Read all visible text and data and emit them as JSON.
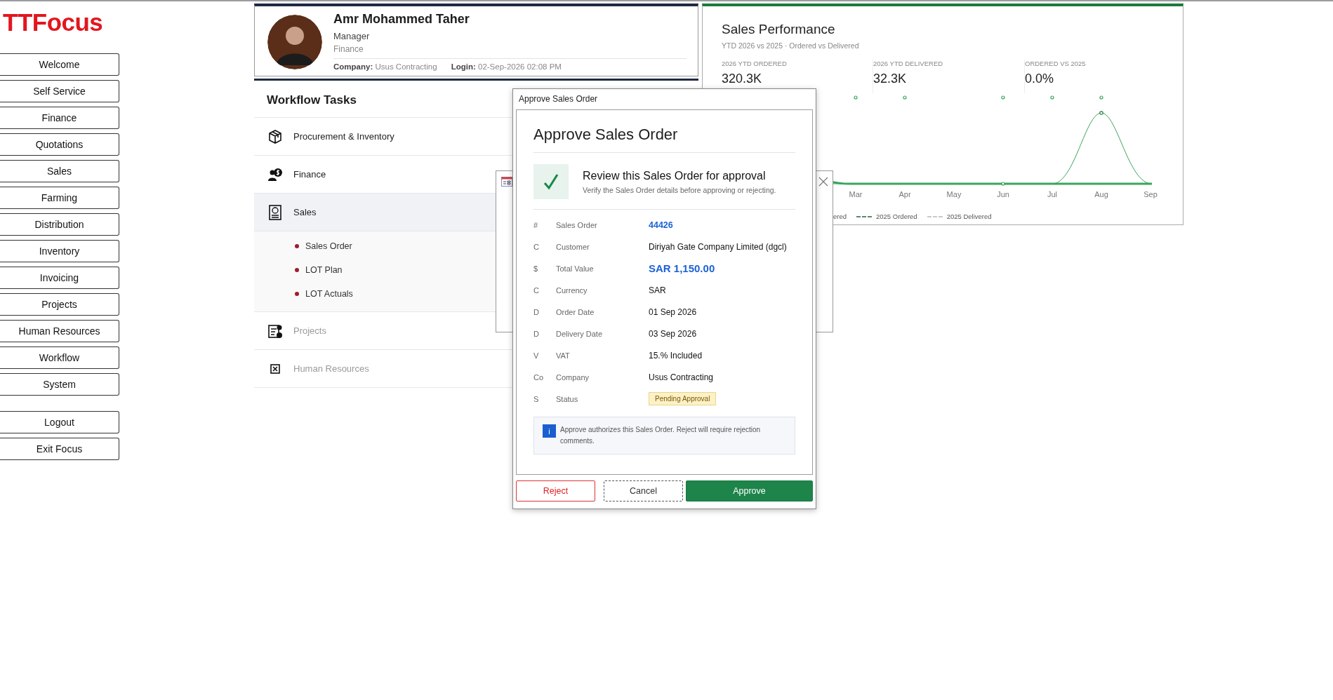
{
  "logo": "TTFocus",
  "nav": [
    {
      "label": "Welcome"
    },
    {
      "label": "Self Service"
    },
    {
      "label": "Finance"
    },
    {
      "label": "Quotations"
    },
    {
      "label": "Sales"
    },
    {
      "label": "Farming"
    },
    {
      "label": "Distribution"
    },
    {
      "label": "Inventory"
    },
    {
      "label": "Invoicing"
    },
    {
      "label": "Projects"
    },
    {
      "label": "Human Resources"
    },
    {
      "label": "Workflow"
    },
    {
      "label": "System"
    }
  ],
  "nav_bottom": [
    {
      "label": "Logout"
    },
    {
      "label": "Exit Focus"
    }
  ],
  "profile": {
    "name": "Amr Mohammed Taher",
    "role": "Manager",
    "department": "Finance",
    "company_label": "Company:",
    "company": "Usus Contracting",
    "login_label": "Login:",
    "login": "02-Sep-2026 02:08 PM"
  },
  "workflow": {
    "title": "Workflow Tasks",
    "items": [
      {
        "label": "Procurement & Inventory",
        "selected": false,
        "disabled": false
      },
      {
        "label": "Finance",
        "selected": false,
        "disabled": false
      },
      {
        "label": "Sales",
        "selected": true,
        "disabled": false,
        "children": [
          {
            "label": "Sales Order"
          },
          {
            "label": "LOT Plan"
          },
          {
            "label": "LOT Actuals"
          }
        ]
      },
      {
        "label": "Projects",
        "selected": false,
        "disabled": true
      },
      {
        "label": "Human Resources",
        "selected": false,
        "disabled": true
      }
    ]
  },
  "sales_performance": {
    "title": "Sales Performance",
    "subtitle": "YTD 2026 vs 2025 · Ordered vs Delivered",
    "kpis": [
      {
        "label": "2026 YTD ORDERED",
        "value": "320.3K"
      },
      {
        "label": "2026 YTD DELIVERED",
        "value": "32.3K"
      },
      {
        "label": "ORDERED VS 2025",
        "value": "0.0%"
      }
    ],
    "months": [
      "Mar",
      "Apr",
      "May",
      "Jun",
      "Jul",
      "Aug",
      "Sep"
    ],
    "legend": [
      {
        "label": "ered"
      },
      {
        "label": "2025 Ordered",
        "color": "#5a8a6a"
      },
      {
        "label": "2025 Delivered",
        "color": "#c4ccc6"
      }
    ]
  },
  "dialog": {
    "window_title": "Approve Sales Order",
    "heading": "Approve Sales Order",
    "review_title": "Review this Sales Order for approval",
    "review_subtitle": "Verify the Sales Order details before approving or rejecting.",
    "fields": [
      {
        "icon": "#",
        "label": "Sales Order",
        "value": "44426",
        "kind": "link"
      },
      {
        "icon": "C",
        "label": "Customer",
        "value": "Diriyah Gate Company Limited (dgcl)",
        "kind": "text"
      },
      {
        "icon": "$",
        "label": "Total Value",
        "value": "SAR 1,150.00",
        "kind": "amount"
      },
      {
        "icon": "C",
        "label": "Currency",
        "value": "SAR",
        "kind": "text"
      },
      {
        "icon": "D",
        "label": "Order Date",
        "value": "01 Sep 2026",
        "kind": "text"
      },
      {
        "icon": "D",
        "label": "Delivery Date",
        "value": "03 Sep 2026",
        "kind": "text"
      },
      {
        "icon": "V",
        "label": "VAT",
        "value": "15.% Included",
        "kind": "text"
      },
      {
        "icon": "Co",
        "label": "Company",
        "value": "Usus Contracting",
        "kind": "text"
      },
      {
        "icon": "S",
        "label": "Status",
        "value": "Pending Approval",
        "kind": "badge"
      }
    ],
    "note_icon": "i",
    "note": "Approve authorizes this Sales Order. Reject will require rejection comments.",
    "buttons": [
      {
        "label": "Reject",
        "kind": "danger"
      },
      {
        "label": "Cancel",
        "kind": "secondary"
      },
      {
        "label": "Approve",
        "kind": "primary"
      }
    ]
  }
}
